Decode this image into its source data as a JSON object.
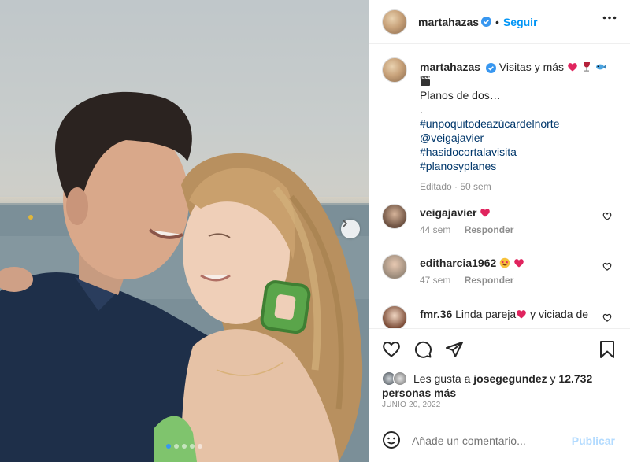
{
  "post": {
    "username": "martahazas",
    "follow_label": "Seguir",
    "separator": "•",
    "caption": {
      "text": "Visitas y más",
      "line2": "Planos de dos…",
      "line3": ".",
      "hashtags": [
        "#unpoquitodeazúcardelnorte",
        "@veigajavier",
        "#hasidocortalavisita",
        "#planosyplanes"
      ],
      "meta": "Editado · 50 sem"
    },
    "comments": [
      {
        "user": "veigajavier",
        "text": "",
        "time": "44 sem",
        "reply": "Responder"
      },
      {
        "user": "editharcia1962",
        "text": "",
        "time": "47 sem",
        "reply": "Responder"
      },
      {
        "user": "fmr.36",
        "text": "Linda pareja",
        "text2": "y viciada de",
        "time": "",
        "reply": ""
      }
    ],
    "likes": {
      "prefix": "Les gusta a",
      "user": "josegegundez",
      "connector": "y",
      "count": "12.732",
      "suffix": "personas más"
    },
    "date": "JUNIO 20, 2022",
    "add_comment_placeholder": "Añade un comentario...",
    "publish_label": "Publicar",
    "carousel": {
      "total": 5,
      "active": 0
    },
    "colors": {
      "accent": "#0095f6",
      "verified": "#3897f0",
      "heart": "#ed4956",
      "publish_disabled": "#b3dbff"
    },
    "icons": [
      "verified-badge-icon",
      "more-icon",
      "heart-icon",
      "comment-icon",
      "share-icon",
      "bookmark-icon",
      "emoji-icon",
      "chevron-right-icon"
    ]
  }
}
